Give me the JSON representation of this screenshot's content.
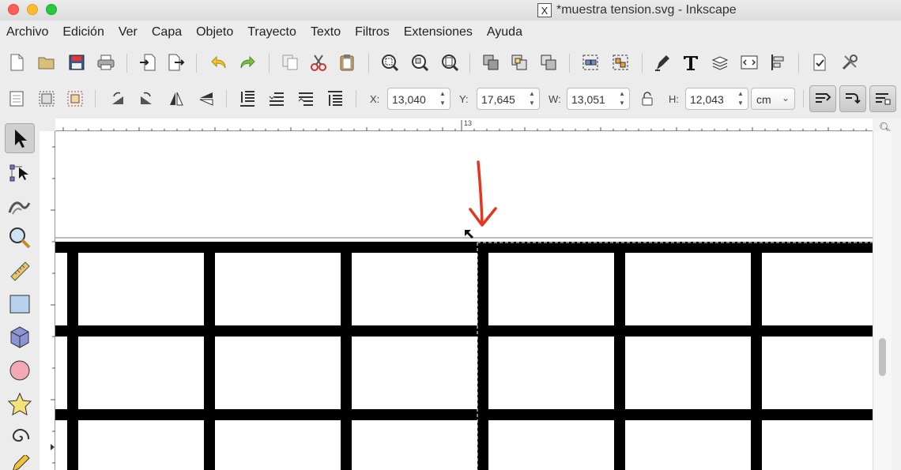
{
  "window": {
    "title": "*muestra tension.svg - Inkscape",
    "app_icon": "x11-icon"
  },
  "menubar": {
    "items": [
      "Archivo",
      "Edición",
      "Ver",
      "Capa",
      "Objeto",
      "Trayecto",
      "Texto",
      "Filtros",
      "Extensiones",
      "Ayuda"
    ]
  },
  "command_toolbar": {
    "icons": [
      "new-document-icon",
      "open-icon",
      "save-icon",
      "print-icon",
      "import-icon",
      "export-icon",
      "undo-icon",
      "redo-icon",
      "duplicate-icon",
      "cut-icon",
      "paste-icon",
      "zoom-selection-icon",
      "zoom-drawing-icon",
      "zoom-page-icon",
      "duplicate-object-icon",
      "clone-icon",
      "unlink-clone-icon",
      "group-icon",
      "ungroup-icon",
      "fill-stroke-icon",
      "text-font-icon",
      "layers-icon",
      "xml-editor-icon",
      "align-distribute-icon",
      "document-properties-icon",
      "preferences-icon"
    ]
  },
  "selector_toolbar": {
    "x_label": "X:",
    "x_value": "13,040",
    "y_label": "Y:",
    "y_value": "17,645",
    "w_label": "W:",
    "w_value": "13,051",
    "h_label": "H:",
    "h_value": "12,043",
    "unit": "cm",
    "lock_icon": "lock-icon"
  },
  "ruler": {
    "top_label": "13"
  },
  "tools": [
    "selector-tool",
    "node-tool",
    "tweak-tool",
    "zoom-tool",
    "measure-tool",
    "rectangle-tool",
    "3d-box-tool",
    "ellipse-tool",
    "star-tool",
    "spiral-tool"
  ],
  "colors": {
    "annotation_arrow": "#e8341c",
    "grid_lines": "#000000",
    "canvas": "#ffffff"
  }
}
